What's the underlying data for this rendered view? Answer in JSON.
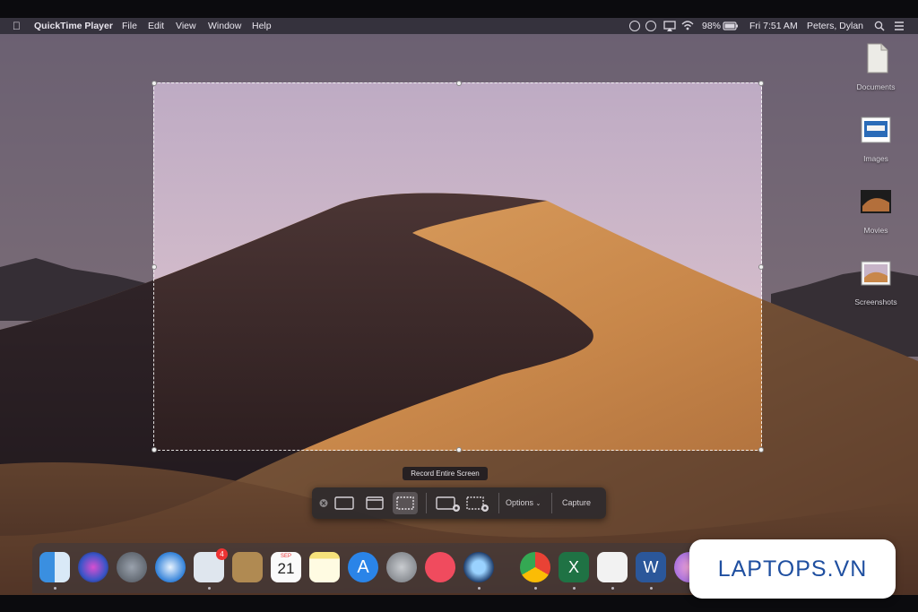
{
  "menubar": {
    "apple_icon": "apple-logo",
    "app_name": "QuickTime Player",
    "menus": [
      "File",
      "Edit",
      "View",
      "Window",
      "Help"
    ],
    "battery": "98%",
    "clock": "Fri 7:51 AM",
    "user": "Peters, Dylan",
    "status_icons": [
      "record-icon",
      "skype-icon",
      "airplay-icon",
      "wifi-icon",
      "battery-icon",
      "search-icon",
      "list-icon"
    ]
  },
  "desktop_icons": [
    {
      "label": "Documents",
      "icon": "documents-icon"
    },
    {
      "label": "Images",
      "icon": "images-icon"
    },
    {
      "label": "Movies",
      "icon": "movies-icon"
    },
    {
      "label": "Screenshots",
      "icon": "screenshots-icon"
    }
  ],
  "tooltip": "Record Entire Screen",
  "toolbar": {
    "close_icon": "close-icon",
    "capture_modes": [
      "capture-entire-screen-icon",
      "capture-window-icon",
      "capture-selection-icon"
    ],
    "record_modes": [
      "record-entire-screen-icon",
      "record-selection-icon"
    ],
    "selected_mode": "capture-selection-icon",
    "options_label": "Options",
    "capture_label": "Capture"
  },
  "dock": {
    "apps": [
      "finder-icon",
      "siri-icon",
      "launchpad-icon",
      "safari-icon",
      "mail-icon",
      "contacts-icon",
      "calendar-icon",
      "notes-icon",
      "app-store-icon",
      "system-preferences-icon",
      "news-icon",
      "quicktime-icon",
      "chrome-icon",
      "excel-icon",
      "screenshot-app-icon",
      "word-icon",
      "itunes-icon"
    ],
    "calendar_month": "SEP",
    "calendar_day": "21",
    "mail_badge": "4"
  },
  "watermark": "LAPTOPS.VN",
  "colors": {
    "sky": "#c7b4c8",
    "dune_light": "#c98a4a",
    "dune_shadow": "#3a2a2c",
    "menubar": "#3a3642",
    "watermark_text": "#1f4fa0"
  }
}
